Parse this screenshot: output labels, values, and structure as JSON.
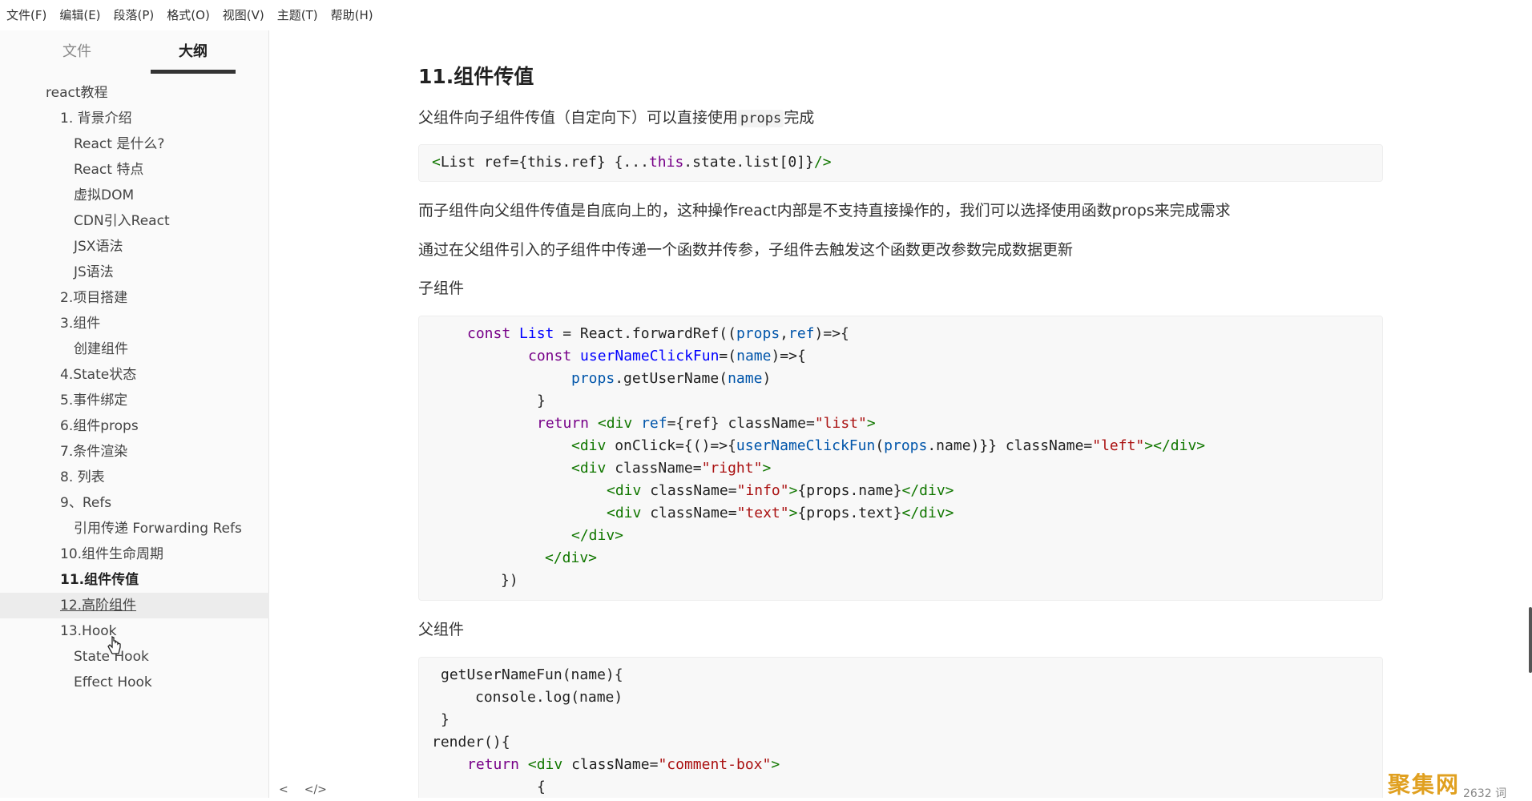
{
  "menu": [
    "文件(F)",
    "编辑(E)",
    "段落(P)",
    "格式(O)",
    "视图(V)",
    "主题(T)",
    "帮助(H)"
  ],
  "sidebar": {
    "tabs": {
      "files": "文件",
      "outline": "大纲"
    },
    "outline": [
      {
        "label": "react教程",
        "level": 1
      },
      {
        "label": "1. 背景介绍",
        "level": 2
      },
      {
        "label": "React 是什么?",
        "level": 3
      },
      {
        "label": "React 特点",
        "level": 3
      },
      {
        "label": "虚拟DOM",
        "level": 3
      },
      {
        "label": "CDN引入React",
        "level": 3
      },
      {
        "label": "JSX语法",
        "level": 3
      },
      {
        "label": "JS语法",
        "level": 3
      },
      {
        "label": "2.项目搭建",
        "level": 2
      },
      {
        "label": "3.组件",
        "level": 2
      },
      {
        "label": "创建组件",
        "level": 3
      },
      {
        "label": "4.State状态",
        "level": 2
      },
      {
        "label": "5.事件绑定",
        "level": 2
      },
      {
        "label": "6.组件props",
        "level": 2
      },
      {
        "label": "7.条件渲染",
        "level": 2
      },
      {
        "label": "8. 列表",
        "level": 2
      },
      {
        "label": "9、Refs",
        "level": 2
      },
      {
        "label": "引用传递 Forwarding Refs",
        "level": 3
      },
      {
        "label": "10.组件生命周期",
        "level": 2
      },
      {
        "label": "11.组件传值",
        "level": 2,
        "active": true
      },
      {
        "label": "12.高阶组件",
        "level": 2,
        "hover": true
      },
      {
        "label": "13.Hook",
        "level": 2
      },
      {
        "label": "State Hook",
        "level": 3
      },
      {
        "label": "Effect Hook",
        "level": 3
      }
    ],
    "footer": {
      "back": "<",
      "source": "</>"
    }
  },
  "document": {
    "heading": "11.组件传值",
    "p1_before": "父组件向子组件传值（自定向下）可以直接使用",
    "p1_code": "props",
    "p1_after": "完成",
    "p2": "而子组件向父组件传值是自底向上的，这种操作react内部是不支持直接操作的，我们可以选择使用函数props来完成需求",
    "p3": "通过在父组件引入的子组件中传递一个函数并传参，子组件去触发这个函数更改参数完成数据更新",
    "label_child": "子组件",
    "label_parent": "父组件"
  },
  "status": {
    "word_count": "2632 词",
    "watermark": "聚集网"
  },
  "colors": {
    "keyword": "#770088",
    "variable": "#0055aa",
    "string": "#aa1111",
    "tag": "#117700"
  }
}
